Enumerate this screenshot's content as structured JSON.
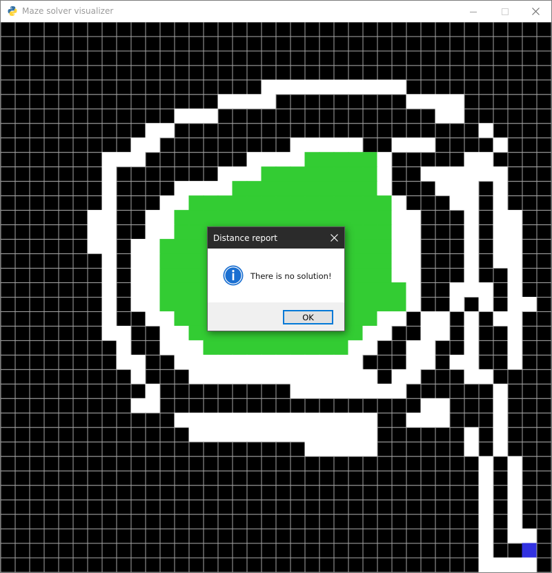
{
  "window": {
    "title": "Maze solver visualizer",
    "icon": "python-icon",
    "controls": [
      "minimize-icon",
      "maximize-icon",
      "close-icon"
    ]
  },
  "maze": {
    "rows": 38,
    "cols": 38,
    "legend": {
      "#": "wall",
      ".": "open",
      "g": "visited",
      "S": "start"
    },
    "grid": [
      "######################################",
      "######################################",
      "######################################",
      "######################################",
      "##################..........##########",
      "###############....#########....######",
      "############...###############..######",
      "##########..#####################.####",
      "#########..#########.....##...####.###",
      "#######...#######....ggggg.#####..####",
      "#######.#######...gggggggg.##......###",
      "#######.####....gggggggggg.###...#.###",
      "#######.###..gggggggggggggg.###..#.###",
      "######..##..ggggggggggggggg..###.#..##",
      "######..##..ggggggggggggggg..###.#..##",
      "######..#..gggggggggggggggg..###.#..##",
      "#######.#..gggggggggggggggg..###.#..##",
      "#######.#..gggggggggggggggg..###.##.##",
      "#######.#..ggggggggggggggggg.##...#.##",
      "#######.#..ggggggggggggggggg.##.#.#..#",
      "#######.##..gggggggggggggg..#..#.#..##",
      "#######..##..gggggggggggg..##..#.##.##",
      "########.##...gggggggggg..##..##.##.##",
      "########..##.............###..#..##.##",
      "#########.###.............#..###..####",
      "##########.#########........######.###",
      "#########..##################..###.###",
      "############..............##...###.###",
      "#############.............######.#.###",
      "#####################.....######.#.###",
      "#################################.#.##",
      "#################################.#.##",
      "#################################.#.##",
      "#################################.#.##",
      "#################################.#.##",
      "#################################.#..#",
      "#################################.##S#",
      "#################################....#"
    ]
  },
  "dialog": {
    "title": "Distance report",
    "icon": "info-icon",
    "message": "There is no solution!",
    "ok_label": "OK"
  },
  "colors": {
    "wall": "#000000",
    "open": "#ffffff",
    "visited": "#33cc33",
    "start": "#3232e0",
    "accent": "#0078d7"
  }
}
